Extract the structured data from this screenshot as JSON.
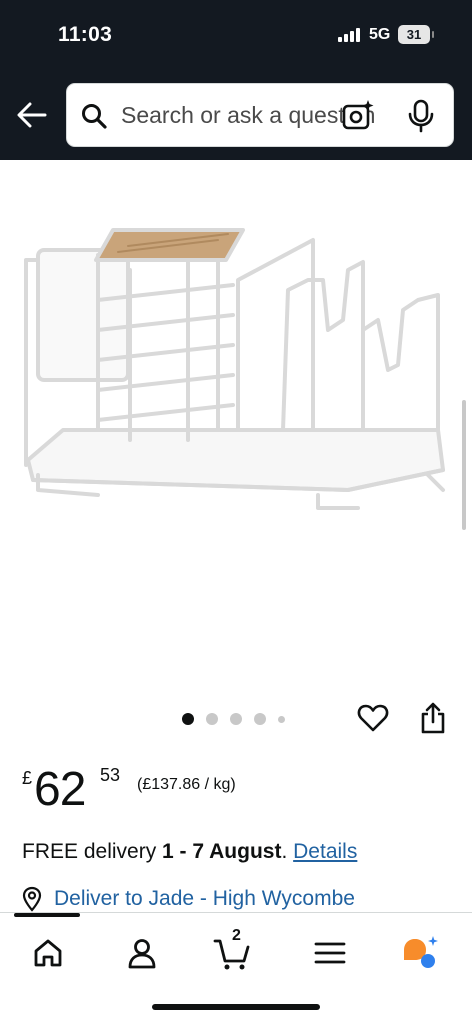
{
  "status_bar": {
    "time": "11:03",
    "network": "5G",
    "battery": "31"
  },
  "search": {
    "placeholder": "Search or ask a question"
  },
  "gallery": {
    "image_count": 5,
    "active_index": 0
  },
  "price": {
    "symbol": "£",
    "whole": "62",
    "fraction": "53",
    "unit_price": "(£137.86 / kg)"
  },
  "delivery": {
    "prefix": "FREE delivery",
    "dates": "1 - 7 August",
    "separator": ".",
    "details_link": "Details"
  },
  "location": {
    "text": "Deliver to Jade - High Wycombe"
  },
  "tabbar": {
    "cart_count": "2"
  },
  "colors": {
    "header_bg": "#131921",
    "link": "#2162a1",
    "rufus_orange": "#f78c2b",
    "rufus_blue": "#2f80ed"
  }
}
